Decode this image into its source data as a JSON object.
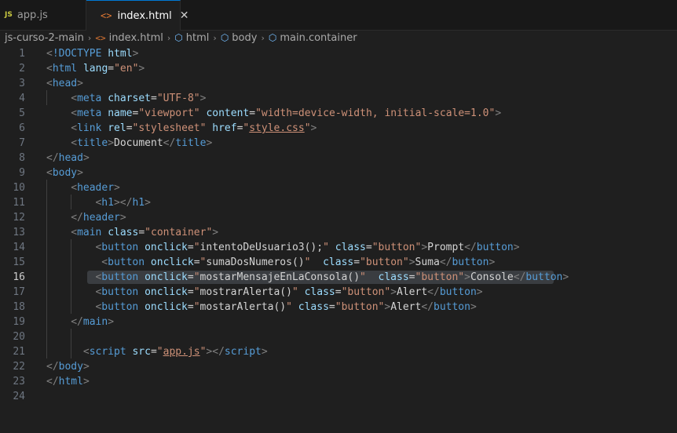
{
  "tabs": [
    {
      "badge": "JS",
      "label": "app.js",
      "active": false
    },
    {
      "badge": "<>",
      "label": "index.html",
      "active": true,
      "close": "✕"
    }
  ],
  "breadcrumb": {
    "items": [
      {
        "label": "js-curso-2-main"
      },
      {
        "label": "index.html",
        "icon": "html-file-icon"
      },
      {
        "label": "html",
        "icon": "cube-icon"
      },
      {
        "label": "body",
        "icon": "cube-icon"
      },
      {
        "label": "main.container",
        "icon": "cube-icon"
      }
    ],
    "separator": "›"
  },
  "editor": {
    "current_line": 16,
    "colors": {
      "tag": "#569cd6",
      "attr": "#9cdcfe",
      "string": "#ce9178",
      "punct": "#808080",
      "text": "#d4d4d4"
    },
    "lines": [
      {
        "n": "1",
        "indent": 0,
        "tokens": [
          [
            "p",
            "<"
          ],
          [
            "t",
            "!DOCTYPE"
          ],
          [
            "x",
            " "
          ],
          [
            "a",
            "html"
          ],
          [
            "p",
            ">"
          ]
        ]
      },
      {
        "n": "2",
        "indent": 0,
        "tokens": [
          [
            "p",
            "<"
          ],
          [
            "t",
            "html"
          ],
          [
            "x",
            " "
          ],
          [
            "a",
            "lang"
          ],
          [
            "x",
            "="
          ],
          [
            "s",
            "\"en\""
          ],
          [
            "p",
            ">"
          ]
        ]
      },
      {
        "n": "3",
        "indent": 0,
        "tokens": [
          [
            "p",
            "<"
          ],
          [
            "t",
            "head"
          ],
          [
            "p",
            ">"
          ]
        ]
      },
      {
        "n": "4",
        "indent": 4,
        "tokens": [
          [
            "p",
            "<"
          ],
          [
            "t",
            "meta"
          ],
          [
            "x",
            " "
          ],
          [
            "a",
            "charset"
          ],
          [
            "x",
            "="
          ],
          [
            "s",
            "\"UTF-8\""
          ],
          [
            "p",
            ">"
          ]
        ]
      },
      {
        "n": "5",
        "indent": 4,
        "tokens": [
          [
            "p",
            "<"
          ],
          [
            "t",
            "meta"
          ],
          [
            "x",
            " "
          ],
          [
            "a",
            "name"
          ],
          [
            "x",
            "="
          ],
          [
            "s",
            "\"viewport\""
          ],
          [
            "x",
            " "
          ],
          [
            "a",
            "content"
          ],
          [
            "x",
            "="
          ],
          [
            "s",
            "\"width=device-width, initial-scale=1.0\""
          ],
          [
            "p",
            ">"
          ]
        ]
      },
      {
        "n": "6",
        "indent": 4,
        "tokens": [
          [
            "p",
            "<"
          ],
          [
            "t",
            "link"
          ],
          [
            "x",
            " "
          ],
          [
            "a",
            "rel"
          ],
          [
            "x",
            "="
          ],
          [
            "s",
            "\"stylesheet\""
          ],
          [
            "x",
            " "
          ],
          [
            "a",
            "href"
          ],
          [
            "x",
            "="
          ],
          [
            "s",
            "\""
          ],
          [
            "su",
            "style.css"
          ],
          [
            "s",
            "\""
          ],
          [
            "p",
            ">"
          ]
        ]
      },
      {
        "n": "7",
        "indent": 4,
        "tokens": [
          [
            "p",
            "<"
          ],
          [
            "t",
            "title"
          ],
          [
            "p",
            ">"
          ],
          [
            "x",
            "Document"
          ],
          [
            "p",
            "</"
          ],
          [
            "t",
            "title"
          ],
          [
            "p",
            ">"
          ]
        ]
      },
      {
        "n": "8",
        "indent": 0,
        "tokens": [
          [
            "p",
            "</"
          ],
          [
            "t",
            "head"
          ],
          [
            "p",
            ">"
          ]
        ]
      },
      {
        "n": "9",
        "indent": 0,
        "tokens": [
          [
            "p",
            "<"
          ],
          [
            "t",
            "body"
          ],
          [
            "p",
            ">"
          ]
        ]
      },
      {
        "n": "10",
        "indent": 4,
        "tokens": [
          [
            "p",
            "<"
          ],
          [
            "t",
            "header"
          ],
          [
            "p",
            ">"
          ]
        ]
      },
      {
        "n": "11",
        "indent": 8,
        "tokens": [
          [
            "p",
            "<"
          ],
          [
            "t",
            "h1"
          ],
          [
            "p",
            "></"
          ],
          [
            "t",
            "h1"
          ],
          [
            "p",
            ">"
          ]
        ]
      },
      {
        "n": "12",
        "indent": 4,
        "tokens": [
          [
            "p",
            "</"
          ],
          [
            "t",
            "header"
          ],
          [
            "p",
            ">"
          ]
        ]
      },
      {
        "n": "13",
        "indent": 4,
        "tokens": [
          [
            "p",
            "<"
          ],
          [
            "t",
            "main"
          ],
          [
            "x",
            " "
          ],
          [
            "a",
            "class"
          ],
          [
            "x",
            "="
          ],
          [
            "s",
            "\"container\""
          ],
          [
            "p",
            ">"
          ]
        ]
      },
      {
        "n": "14",
        "indent": 8,
        "tokens": [
          [
            "p",
            "<"
          ],
          [
            "t",
            "button"
          ],
          [
            "x",
            " "
          ],
          [
            "a",
            "onclick"
          ],
          [
            "x",
            "="
          ],
          [
            "s",
            "\""
          ],
          [
            "x",
            "intentoDeUsuario3();"
          ],
          [
            "s",
            "\""
          ],
          [
            "x",
            " "
          ],
          [
            "a",
            "class"
          ],
          [
            "x",
            "="
          ],
          [
            "s",
            "\"button\""
          ],
          [
            "p",
            ">"
          ],
          [
            "x",
            "Prompt"
          ],
          [
            "p",
            "</"
          ],
          [
            "t",
            "button"
          ],
          [
            "p",
            ">"
          ]
        ]
      },
      {
        "n": "15",
        "indent": 8,
        "pre": " ",
        "tokens": [
          [
            "p",
            "<"
          ],
          [
            "t",
            "button"
          ],
          [
            "x",
            " "
          ],
          [
            "a",
            "onclick"
          ],
          [
            "x",
            "="
          ],
          [
            "s",
            "\""
          ],
          [
            "x",
            "sumaDosNumeros()"
          ],
          [
            "s",
            "\""
          ],
          [
            "x",
            "  "
          ],
          [
            "a",
            "class"
          ],
          [
            "x",
            "="
          ],
          [
            "s",
            "\"button\""
          ],
          [
            "p",
            ">"
          ],
          [
            "x",
            "Suma"
          ],
          [
            "p",
            "</"
          ],
          [
            "t",
            "button"
          ],
          [
            "p",
            ">"
          ]
        ]
      },
      {
        "n": "16",
        "indent": 8,
        "tokens": [
          [
            "p",
            "<"
          ],
          [
            "t",
            "button"
          ],
          [
            "x",
            " "
          ],
          [
            "a",
            "onclick"
          ],
          [
            "x",
            "="
          ],
          [
            "s",
            "\""
          ],
          [
            "x",
            "mostarMensajeEnLaConsola()"
          ],
          [
            "s",
            "\""
          ],
          [
            "x",
            "  "
          ],
          [
            "a",
            "class"
          ],
          [
            "x",
            "="
          ],
          [
            "s",
            "\"button\""
          ],
          [
            "p",
            ">"
          ],
          [
            "x",
            "Console"
          ],
          [
            "p",
            "</"
          ],
          [
            "t",
            "button"
          ],
          [
            "p",
            ">"
          ]
        ]
      },
      {
        "n": "17",
        "indent": 8,
        "tokens": [
          [
            "p",
            "<"
          ],
          [
            "t",
            "button"
          ],
          [
            "x",
            " "
          ],
          [
            "a",
            "onclick"
          ],
          [
            "x",
            "="
          ],
          [
            "s",
            "\""
          ],
          [
            "x",
            "mostrarAlerta()"
          ],
          [
            "s",
            "\""
          ],
          [
            "x",
            " "
          ],
          [
            "a",
            "class"
          ],
          [
            "x",
            "="
          ],
          [
            "s",
            "\"button\""
          ],
          [
            "p",
            ">"
          ],
          [
            "x",
            "Alert"
          ],
          [
            "p",
            "</"
          ],
          [
            "t",
            "button"
          ],
          [
            "p",
            ">"
          ]
        ]
      },
      {
        "n": "18",
        "indent": 8,
        "tokens": [
          [
            "p",
            "<"
          ],
          [
            "t",
            "button"
          ],
          [
            "x",
            " "
          ],
          [
            "a",
            "onclick"
          ],
          [
            "x",
            "="
          ],
          [
            "s",
            "\""
          ],
          [
            "x",
            "mostarAlerta()"
          ],
          [
            "s",
            "\""
          ],
          [
            "x",
            " "
          ],
          [
            "a",
            "class"
          ],
          [
            "x",
            "="
          ],
          [
            "s",
            "\"button\""
          ],
          [
            "p",
            ">"
          ],
          [
            "x",
            "Alert"
          ],
          [
            "p",
            "</"
          ],
          [
            "t",
            "button"
          ],
          [
            "p",
            ">"
          ]
        ]
      },
      {
        "n": "19",
        "indent": 4,
        "tokens": [
          [
            "p",
            "</"
          ],
          [
            "t",
            "main"
          ],
          [
            "p",
            ">"
          ]
        ]
      },
      {
        "n": "20",
        "indent": 0,
        "tokens": []
      },
      {
        "n": "21",
        "indent": 6,
        "tokens": [
          [
            "p",
            "<"
          ],
          [
            "t",
            "script"
          ],
          [
            "x",
            " "
          ],
          [
            "a",
            "src"
          ],
          [
            "x",
            "="
          ],
          [
            "s",
            "\""
          ],
          [
            "su",
            "app.js"
          ],
          [
            "s",
            "\""
          ],
          [
            "p",
            "></"
          ],
          [
            "t",
            "script"
          ],
          [
            "p",
            ">"
          ]
        ]
      },
      {
        "n": "22",
        "indent": 0,
        "tokens": [
          [
            "p",
            "</"
          ],
          [
            "t",
            "body"
          ],
          [
            "p",
            ">"
          ]
        ]
      },
      {
        "n": "23",
        "indent": 0,
        "tokens": [
          [
            "p",
            "</"
          ],
          [
            "t",
            "html"
          ],
          [
            "p",
            ">"
          ]
        ]
      },
      {
        "n": "24",
        "indent": 0,
        "tokens": []
      }
    ]
  }
}
